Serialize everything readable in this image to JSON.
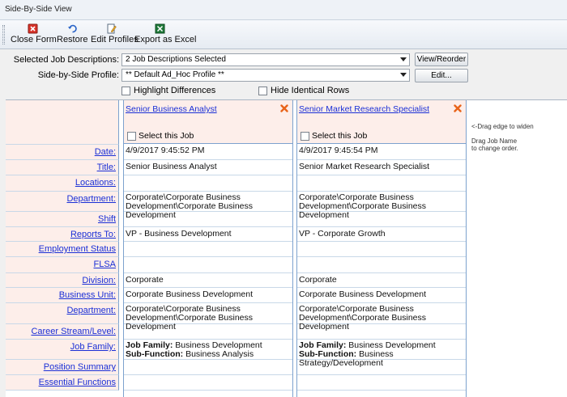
{
  "window": {
    "title": "Side-By-Side View"
  },
  "toolbar": {
    "close_form": "Close Form",
    "restore": "Restore",
    "edit_profiles": "Edit Profiles",
    "export_excel": "Export as Excel"
  },
  "form": {
    "selected_jd_label": "Selected Job Descriptions:",
    "selected_jd_value": "2 Job Descriptions Selected",
    "view_reorder": "View/Reorder",
    "profile_label": "Side-by-Side Profile:",
    "profile_value": "** Default Ad_Hoc Profile **",
    "edit_button": "Edit...",
    "highlight_differences": "Highlight Differences",
    "hide_identical_rows": "Hide Identical Rows"
  },
  "side_notes": {
    "drag_edge": "<-Drag edge to widen",
    "drag_job_name_1": "Drag Job Name",
    "drag_job_name_2": "to change order."
  },
  "rows": {
    "date": "Date:",
    "title": "Title:",
    "locations": "Locations:",
    "department": "Department:",
    "shift": "Shift",
    "reports_to": "Reports To:",
    "employment_status": "Employment Status",
    "flsa": "FLSA",
    "division": "Division:",
    "business_unit": "Business Unit:",
    "department2": "Department:",
    "career_stream": "Career Stream/Level:",
    "job_family": "Job Family:",
    "position_summary": "Position Summary",
    "essential_functions": "Essential Functions"
  },
  "jobs": [
    {
      "name": "Senior Business Analyst",
      "select_label": "Select this Job",
      "date": "4/9/2017 9:45:52 PM",
      "title": "Senior Business Analyst",
      "department_1": "Corporate\\Corporate Business",
      "department_2": "Development\\Corporate Business Development",
      "reports_to": "VP - Business Development",
      "division": "Corporate",
      "business_unit": "Corporate Business Development",
      "dept2_1": "Corporate\\Corporate Business",
      "dept2_2": "Development\\Corporate Business Development",
      "job_family_label": "Job Family:",
      "job_family": " Business Development",
      "sub_function_label": "Sub-Function:",
      "sub_function": " Business Analysis"
    },
    {
      "name": "Senior Market Research Specialist",
      "select_label": "Select this Job",
      "date": "4/9/2017 9:45:54 PM",
      "title": "Senior Market Research Specialist",
      "department_1": "Corporate\\Corporate Business",
      "department_2": "Development\\Corporate Business Development",
      "reports_to": "VP - Corporate Growth",
      "division": "Corporate",
      "business_unit": "Corporate Business Development",
      "dept2_1": "Corporate\\Corporate Business",
      "dept2_2": "Development\\Corporate Business Development",
      "job_family_label": "Job Family:",
      "job_family": " Business Development",
      "sub_function_label": "Sub-Function:",
      "sub_function": " Business Strategy/Development"
    }
  ],
  "colors": {
    "label_bg": "#fdeeea",
    "link": "#1a2fd6",
    "border": "#7da2ce",
    "remove_icon": "#e8641a"
  },
  "icons": [
    "close-form-icon",
    "restore-icon",
    "edit-profiles-icon",
    "export-excel-icon",
    "remove-job-icon"
  ]
}
